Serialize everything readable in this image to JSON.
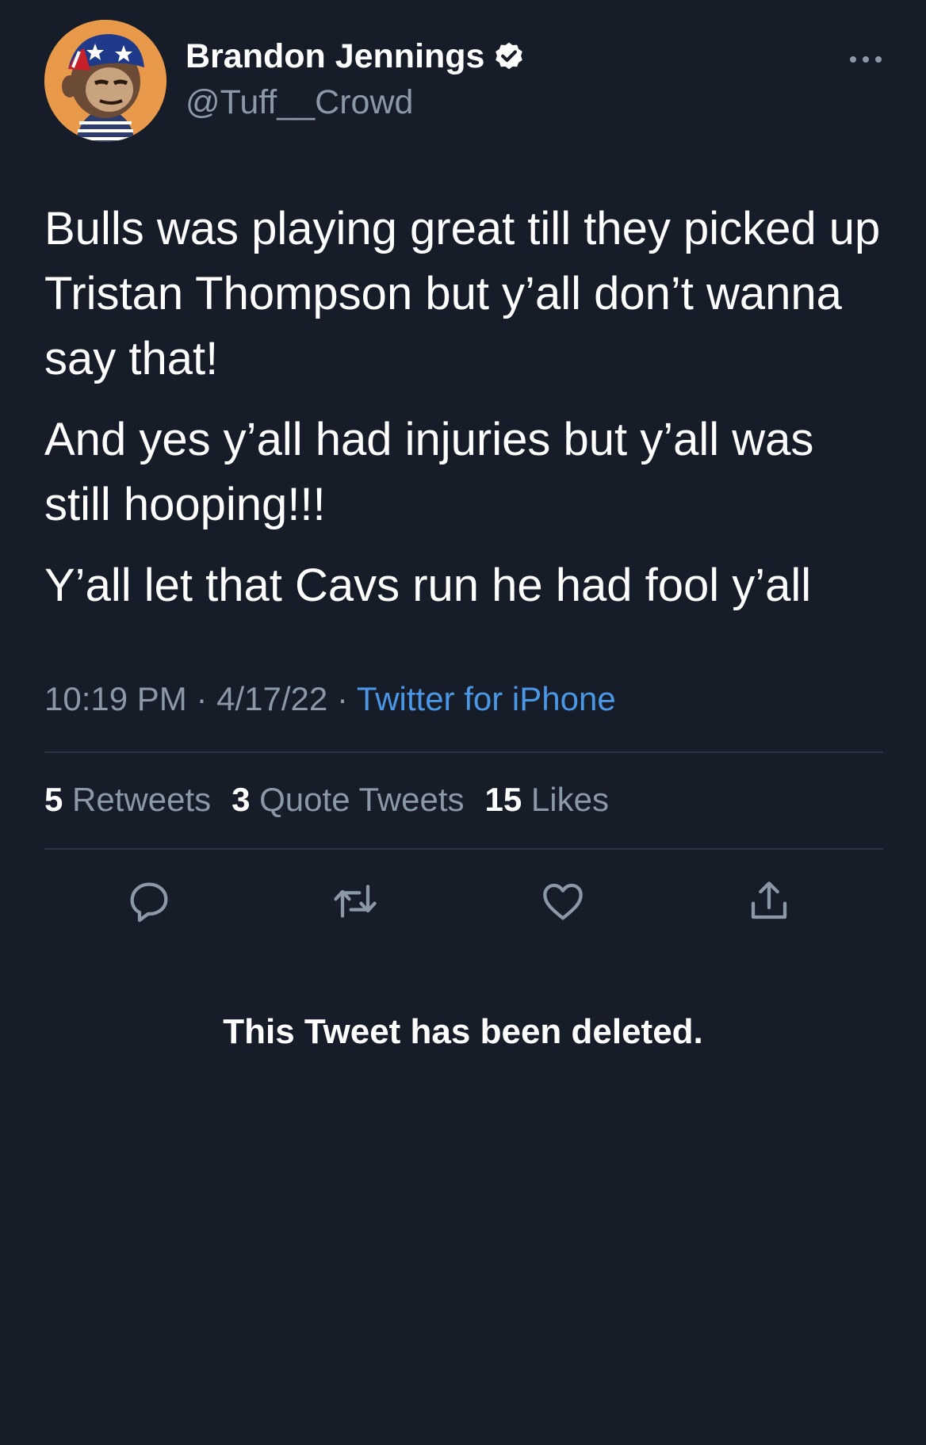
{
  "author": {
    "display_name": "Brandon Jennings",
    "handle": "@Tuff__Crowd",
    "verified": true,
    "avatar_icon": "ape-avatar"
  },
  "tweet": {
    "paragraphs": [
      "Bulls was playing great till they picked up Tristan Thompson but y’all don’t wanna say that!",
      "And yes y’all had injuries but y’all was still hooping!!!",
      "Y’all let that Cavs run he had fool y’all"
    ],
    "time": "10:19 PM",
    "separator": "·",
    "date": "4/17/22",
    "source": "Twitter for iPhone"
  },
  "stats": {
    "retweets_count": "5",
    "retweets_label": "Retweets",
    "quotes_count": "3",
    "quotes_label": "Quote Tweets",
    "likes_count": "15",
    "likes_label": "Likes"
  },
  "actions": [
    "reply-icon",
    "retweet-icon",
    "like-icon",
    "share-icon"
  ],
  "notice": "This Tweet has been deleted.",
  "colors": {
    "background": "#161c28",
    "muted": "#8b98a5",
    "link": "#4a97e6",
    "divider": "#2b3443"
  }
}
